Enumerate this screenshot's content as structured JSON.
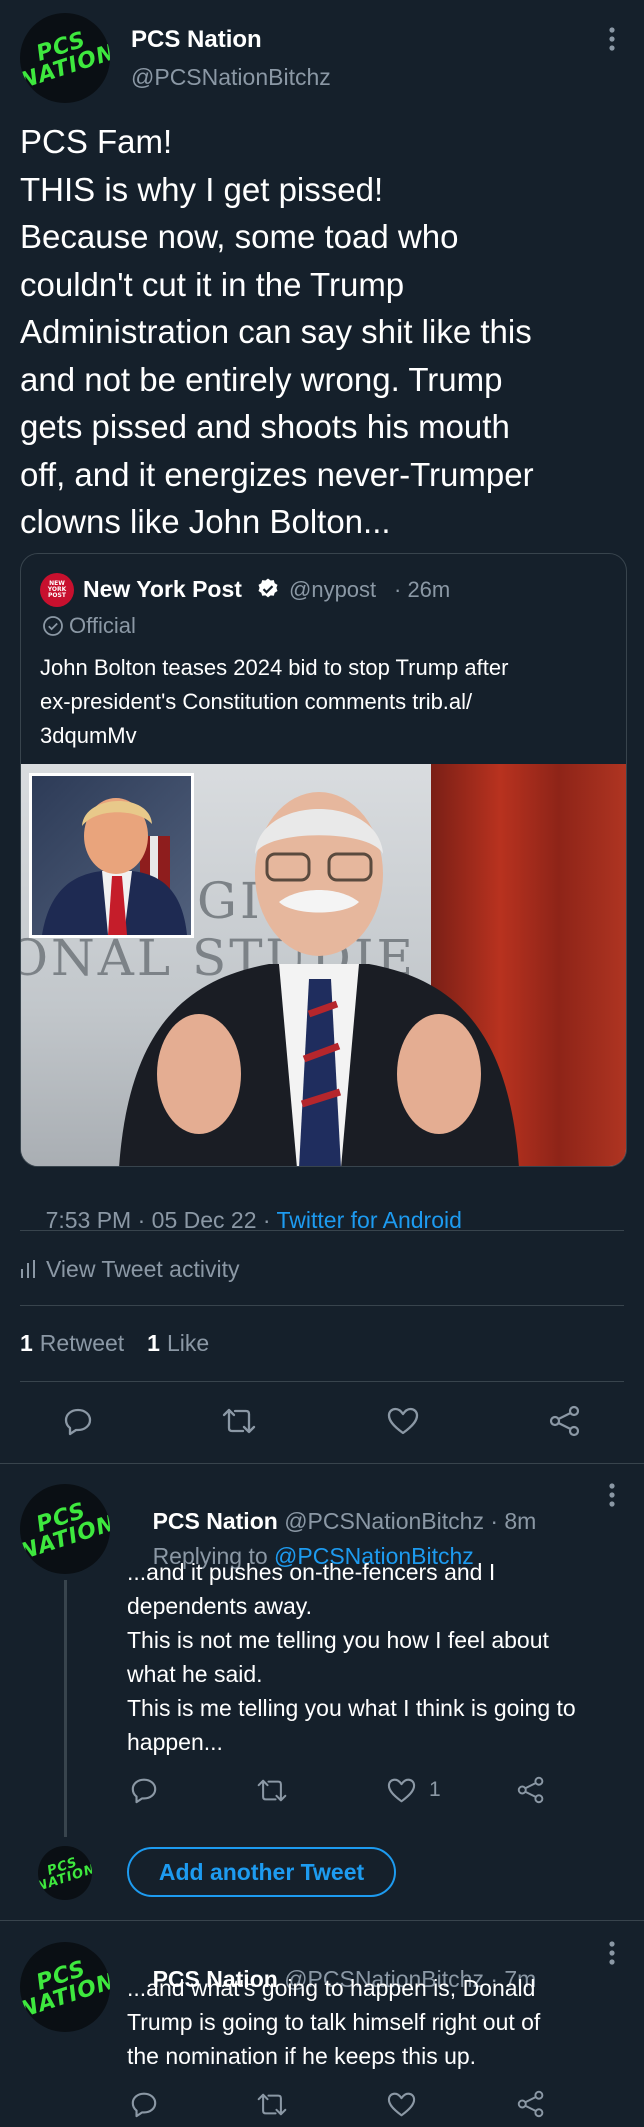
{
  "colors": {
    "background": "#15202b",
    "accent": "#1d9bf0",
    "muted": "#8b98a5",
    "avatar_text": "#3ee83e"
  },
  "main_tweet": {
    "author_name": "PCS Nation",
    "author_handle": "@PCSNationBitchz",
    "avatar_text": "PCS\nNATION",
    "text_lines": [
      "PCS Fam!",
      "THIS is why I get pissed!",
      "Because now, some toad who",
      "couldn't cut it in the Trump",
      "Administration can say shit like this",
      "and not be entirely wrong. Trump",
      "gets pissed and shoots his mouth",
      "off, and it energizes never-Trumper",
      "clowns like John Bolton..."
    ],
    "quote": {
      "name": "New York Post",
      "handle": "@nypost",
      "time": "· 26m",
      "label": "Official",
      "logo_text": "NEW YORK POST",
      "text_lines": [
        "John Bolton teases 2024 bid to stop Trump after",
        "ex-president's Constitution comments trib.al/",
        "3dqumMv"
      ],
      "photo_bg_text_1": "GIC",
      "photo_bg_text_2": "ONAL STUDIE"
    },
    "timestamp": "7:53 PM · 05 Dec 22 · ",
    "source": "Twitter for Android",
    "activity_label": "View Tweet activity",
    "retweet_count": "1",
    "retweet_label": "Retweet",
    "like_count": "1",
    "like_label": "Like"
  },
  "reply_1": {
    "author_name": "PCS Nation",
    "author_handle": "@PCSNationBitchz",
    "time": "· 8m",
    "replying_prefix": "Replying to",
    "replying_to": "@PCSNationBitchz",
    "text_lines": [
      "...and it pushes on-the-fencers and I",
      "dependents away.",
      "This is not me telling you how I feel about",
      "what he said.",
      "This is me telling you what I think is going to",
      "happen..."
    ],
    "like_count": "1"
  },
  "add_tweet_label": "Add another Tweet",
  "reply_2": {
    "author_name": "PCS Nation",
    "author_handle": "@PCSNationBitchz",
    "time": "· 7m",
    "text_lines": [
      "...and what's going to happen is, Donald",
      "Trump is going to talk himself right out of",
      "the nomination if he keeps this up."
    ]
  }
}
